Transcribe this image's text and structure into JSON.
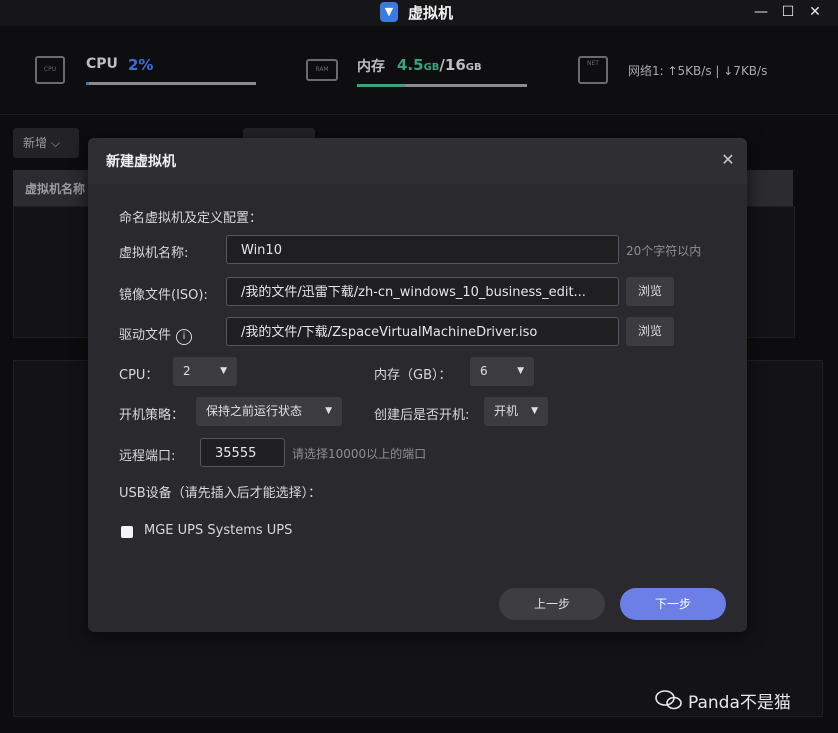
{
  "window": {
    "title": "虚拟机",
    "minimize": "—",
    "maximize": "☐",
    "close": "✕"
  },
  "stats": {
    "cpu_chip": "CPU",
    "cpu_label": "CPU",
    "cpu_value": "2%",
    "cpu_usage": 0.02,
    "mem_chip": "RAM",
    "mem_label": "内存",
    "mem_value": "4.5",
    "mem_used_unit": "GB",
    "mem_sep": "/",
    "mem_total": "16",
    "mem_total_unit": "GB",
    "mem_usage": 0.28,
    "net_chip": "NET",
    "net_text": "网络1: ↑5KB/s | ↓7KB/s"
  },
  "background": {
    "new_button": "新增 ⌵",
    "column_name": "虚拟机名称"
  },
  "dialog": {
    "title": "新建虚拟机",
    "close": "✕",
    "section_title": "命名虚拟机及定义配置：",
    "name_label": "虚拟机名称:",
    "name_value": "Win10",
    "name_hint": "20个字符以内",
    "iso_label": "镜像文件(ISO):",
    "iso_value": "/我的文件/迅雷下载/zh-cn_windows_10_business_edit...",
    "iso_browse": "浏览",
    "driver_label": "驱动文件",
    "driver_info": "i",
    "driver_value": "/我的文件/下载/ZspaceVirtualMachineDriver.iso",
    "driver_browse": "浏览",
    "cpu_label": "CPU：",
    "cpu_value": "2",
    "mem_label": "内存（GB）：",
    "mem_value": "6",
    "boot_policy_label": "开机策略：",
    "boot_policy_value": "保持之前运行状态",
    "boot_after_label": "创建后是否开机:",
    "boot_after_value": "开机",
    "port_label": "远程端口:",
    "port_value": "35555",
    "port_hint": "请选择10000以上的端口",
    "usb_label": "USB设备（请先插入后才能选择）：",
    "usb_device": "MGE UPS Systems UPS",
    "usb_checked": false,
    "prev_button": "上一步",
    "next_button": "下一步"
  },
  "watermark": "Panda不是猫",
  "colors": {
    "accent": "#6b7fe6",
    "cpu_bar": "#3a6fd8",
    "mem_bar": "#3aa37a"
  }
}
